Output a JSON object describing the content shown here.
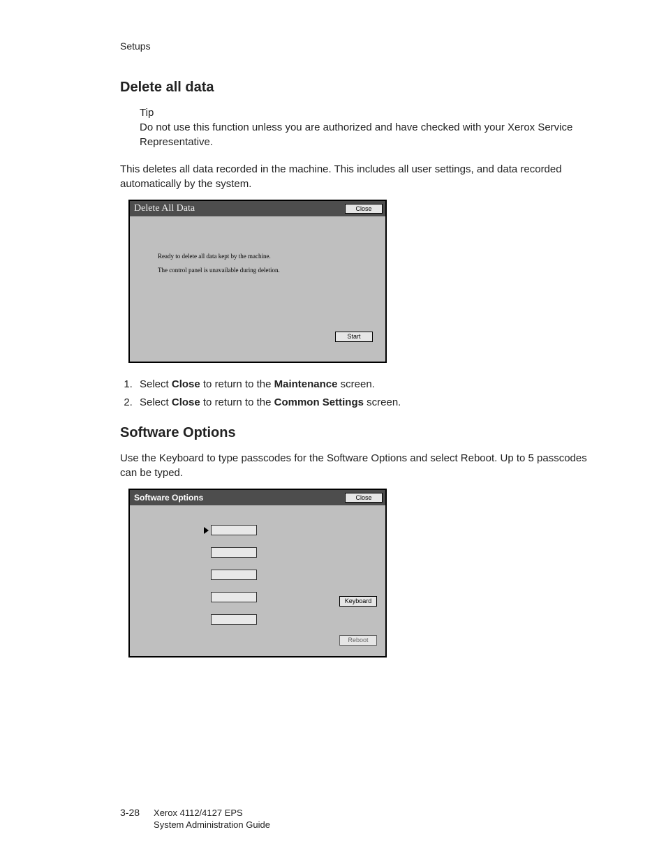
{
  "header": {
    "section": "Setups"
  },
  "s1": {
    "title": "Delete all data",
    "tip_label": "Tip",
    "tip_body": "Do not use this function unless you are authorized and have checked with your Xerox Service Representative.",
    "intro": "This deletes all data recorded in the machine. This includes all user settings, and data recorded automatically by the system.",
    "ss": {
      "title": "Delete All Data",
      "close": "Close",
      "msg1": "Ready to delete all data kept by the machine.",
      "msg2": "The control panel is unavailable during deletion.",
      "start": "Start"
    },
    "steps": {
      "step1": {
        "a": "Select ",
        "b": "Close",
        "c": " to return to the ",
        "d": "Maintenance",
        "e": " screen."
      },
      "step2": {
        "a": "Select ",
        "b": "Close",
        "c": " to return to the ",
        "d": "Common Settings",
        "e": " screen."
      }
    }
  },
  "s2": {
    "title": "Software Options",
    "intro": "Use the Keyboard to type passcodes for the Software Options and select Reboot. Up to 5 passcodes can be typed.",
    "ss": {
      "title": "Software Options",
      "close": "Close",
      "keyboard": "Keyboard",
      "reboot": "Reboot"
    }
  },
  "footer": {
    "page": "3-28",
    "line1": "Xerox 4112/4127 EPS",
    "line2": "System Administration Guide"
  }
}
